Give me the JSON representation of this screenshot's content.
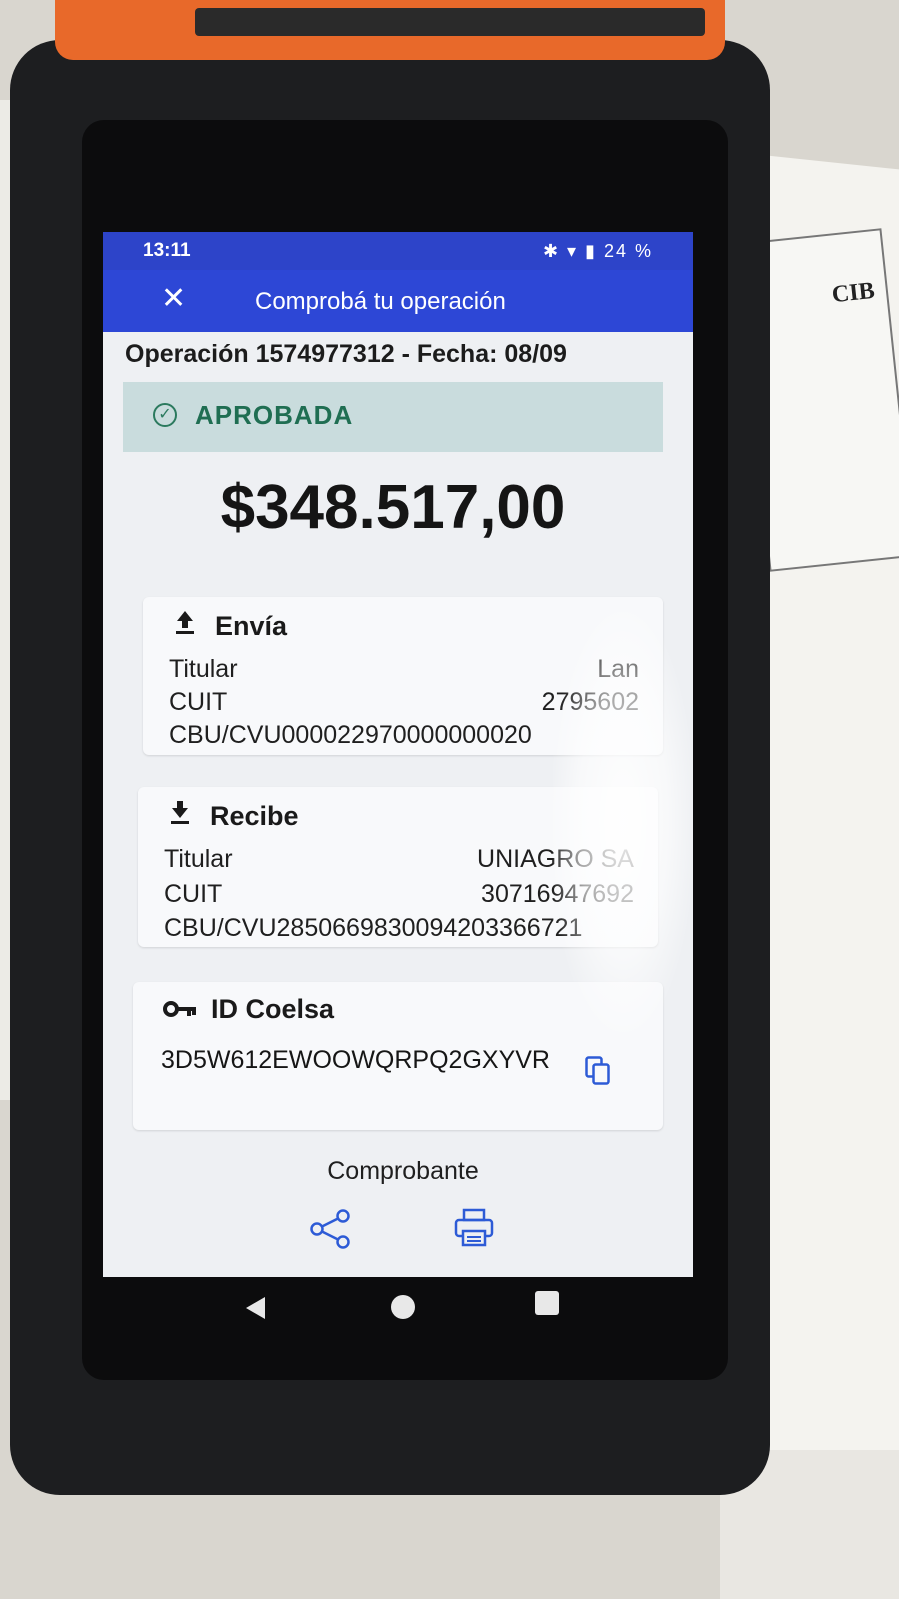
{
  "status_bar": {
    "time": "13:11",
    "icons": "✱ ▾ ▮ 24 %"
  },
  "app_bar": {
    "close_icon": "close-icon",
    "title": "Comprobá tu operación"
  },
  "operation": {
    "line": "Operación 1574977312 - Fecha: 08/09"
  },
  "status": {
    "label": "APROBADA",
    "color": "#1f6e52"
  },
  "amount": "$348.517,00",
  "sender": {
    "heading": "Envía",
    "titular_label": "Titular",
    "titular_value": "Lan",
    "cuit_label": "CUIT",
    "cuit_value": "2795602",
    "cbu_label": "CBU/CVU",
    "cbu_value": "000022970000000020"
  },
  "receiver": {
    "heading": "Recibe",
    "titular_label": "Titular",
    "titular_value": "UNIAGRO SA",
    "cuit_label": "CUIT",
    "cuit_value": "30716947692",
    "cbu_label": "CBU/CVU",
    "cbu_value": "2850669830094203366721"
  },
  "coelsa": {
    "heading": "ID Coelsa",
    "id": "3D5W612EWOOWQRPQ2GXYVR"
  },
  "receipt": {
    "label": "Comprobante"
  },
  "colors": {
    "primary": "#2d47d6",
    "status_bar": "#2d44c9",
    "accent_icon": "#2d5bd6",
    "printer_orange": "#e8692a"
  },
  "paper_text": {
    "right_title": "CIB"
  }
}
